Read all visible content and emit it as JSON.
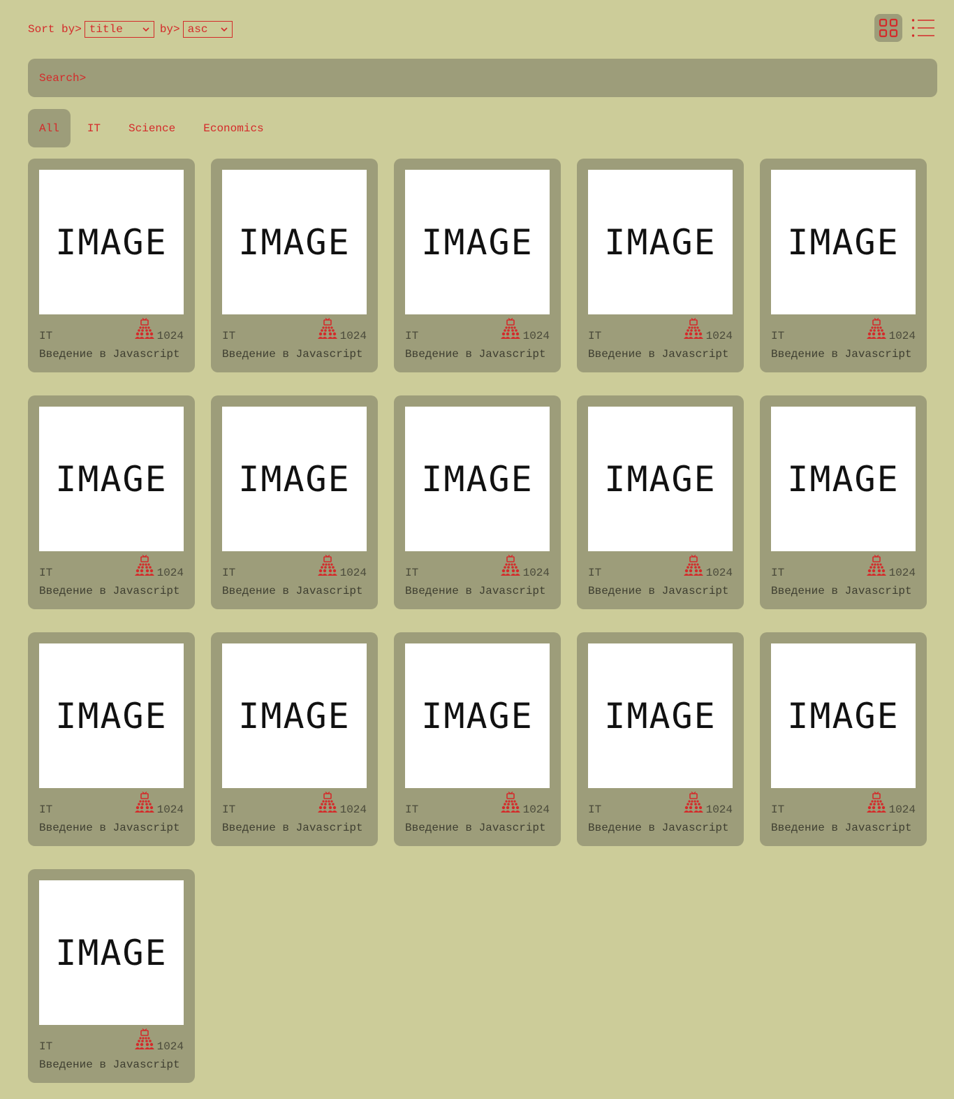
{
  "toolbar": {
    "sort_label": "Sort by>",
    "sort_value": "title",
    "order_label": "by>",
    "order_value": "asc",
    "view_grid_icon": "grid-view-icon",
    "view_list_icon": "list-view-icon"
  },
  "search": {
    "placeholder": "Search>"
  },
  "categories": [
    {
      "label": "All",
      "active": true
    },
    {
      "label": "IT",
      "active": false
    },
    {
      "label": "Science",
      "active": false
    },
    {
      "label": "Economics",
      "active": false
    }
  ],
  "courses": [
    {
      "image_text": "IMAGE",
      "category": "IT",
      "count": "1024",
      "title": "Введение в Javascript"
    },
    {
      "image_text": "IMAGE",
      "category": "IT",
      "count": "1024",
      "title": "Введение в Javascript"
    },
    {
      "image_text": "IMAGE",
      "category": "IT",
      "count": "1024",
      "title": "Введение в Javascript"
    },
    {
      "image_text": "IMAGE",
      "category": "IT",
      "count": "1024",
      "title": "Введение в Javascript"
    },
    {
      "image_text": "IMAGE",
      "category": "IT",
      "count": "1024",
      "title": "Введение в Javascript"
    },
    {
      "image_text": "IMAGE",
      "category": "IT",
      "count": "1024",
      "title": "Введение в Javascript"
    },
    {
      "image_text": "IMAGE",
      "category": "IT",
      "count": "1024",
      "title": "Введение в Javascript"
    },
    {
      "image_text": "IMAGE",
      "category": "IT",
      "count": "1024",
      "title": "Введение в Javascript"
    },
    {
      "image_text": "IMAGE",
      "category": "IT",
      "count": "1024",
      "title": "Введение в Javascript"
    },
    {
      "image_text": "IMAGE",
      "category": "IT",
      "count": "1024",
      "title": "Введение в Javascript"
    },
    {
      "image_text": "IMAGE",
      "category": "IT",
      "count": "1024",
      "title": "Введение в Javascript"
    },
    {
      "image_text": "IMAGE",
      "category": "IT",
      "count": "1024",
      "title": "Введение в Javascript"
    },
    {
      "image_text": "IMAGE",
      "category": "IT",
      "count": "1024",
      "title": "Введение в Javascript"
    },
    {
      "image_text": "IMAGE",
      "category": "IT",
      "count": "1024",
      "title": "Введение в Javascript"
    },
    {
      "image_text": "IMAGE",
      "category": "IT",
      "count": "1024",
      "title": "Введение в Javascript"
    },
    {
      "image_text": "IMAGE",
      "category": "IT",
      "count": "1024",
      "title": "Введение в Javascript"
    }
  ],
  "colors": {
    "background": "#cccc99",
    "panel": "#9d9d7a",
    "accent": "#d42a2a",
    "text": "#3e3e30"
  }
}
